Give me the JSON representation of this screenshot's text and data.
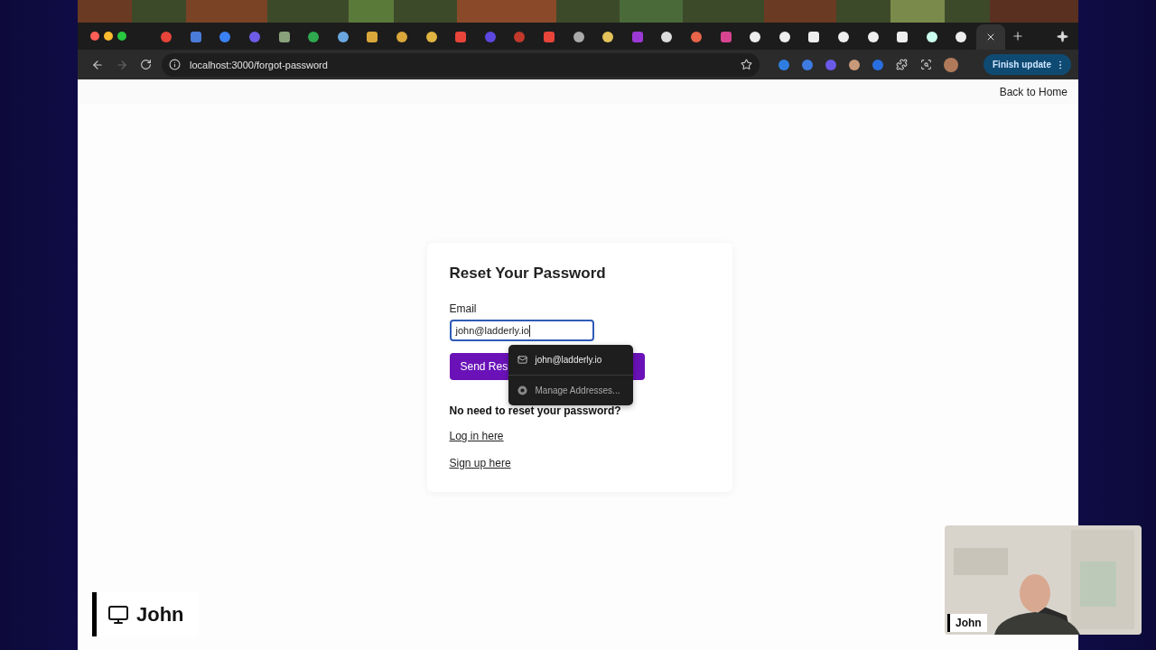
{
  "tabs": [
    {
      "selected": false
    },
    {
      "selected": false
    },
    {
      "selected": false
    },
    {
      "selected": false
    },
    {
      "selected": false
    },
    {
      "selected": false
    },
    {
      "selected": false
    },
    {
      "selected": false
    },
    {
      "selected": false
    },
    {
      "selected": false
    },
    {
      "selected": false
    },
    {
      "selected": false
    },
    {
      "selected": false
    },
    {
      "selected": false
    },
    {
      "selected": false
    },
    {
      "selected": false
    },
    {
      "selected": false
    },
    {
      "selected": false
    },
    {
      "selected": false
    },
    {
      "selected": false
    },
    {
      "selected": false
    },
    {
      "selected": false
    },
    {
      "selected": false
    },
    {
      "selected": false
    },
    {
      "selected": false
    },
    {
      "selected": false
    },
    {
      "selected": false
    },
    {
      "selected": false
    },
    {
      "selected": true
    }
  ],
  "address_bar": {
    "url": "localhost:3000/forgot-password"
  },
  "toolbar": {
    "update_button": "Finish update"
  },
  "nav": {
    "back_link": "Back to Home"
  },
  "form": {
    "title": "Reset Your Password",
    "email_label": "Email",
    "email_value": "john@ladderly.io",
    "submit_button": "Send Res",
    "footer_heading": "No need to reset your password?",
    "links": [
      "Log in here",
      "Sign up here"
    ]
  },
  "autofill": {
    "items": [
      {
        "kind": "suggestion",
        "label": "john@ladderly.io"
      },
      {
        "kind": "manage",
        "label": "Manage Addresses..."
      }
    ]
  },
  "presenter": {
    "name": "John"
  },
  "webcam": {
    "name": "John"
  }
}
